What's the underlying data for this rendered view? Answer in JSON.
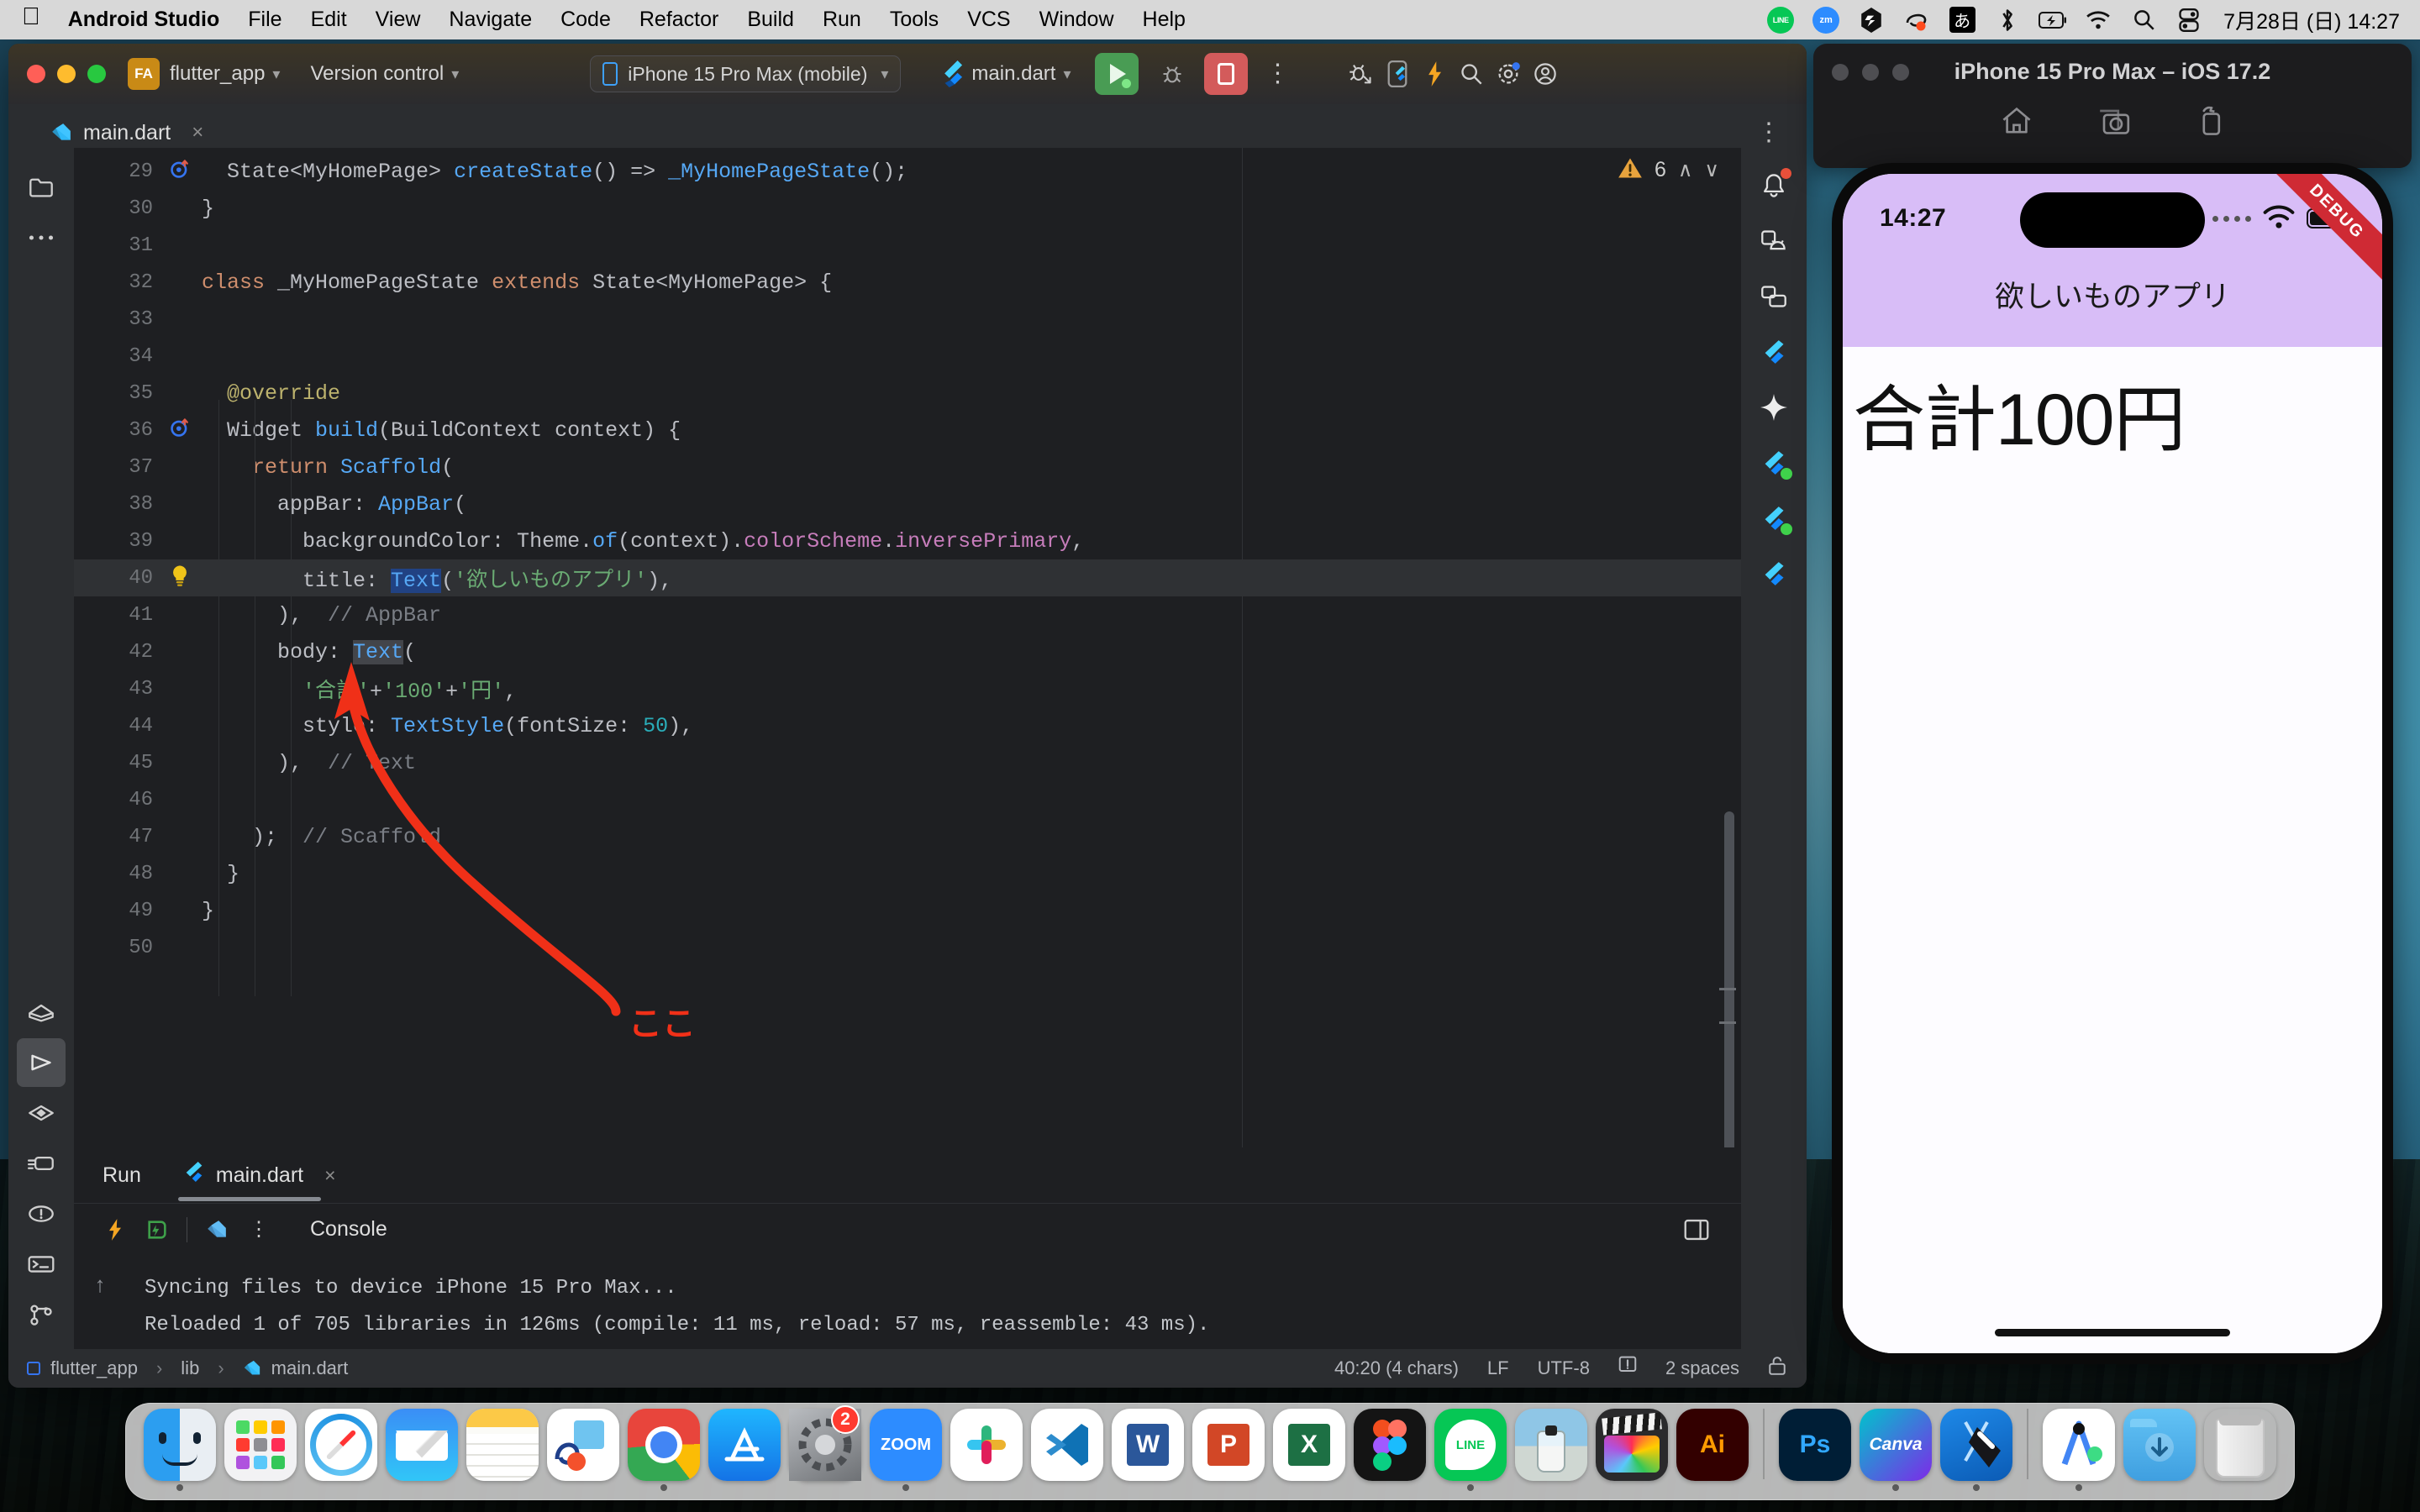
{
  "menubar": {
    "apple": "",
    "items": [
      {
        "label": "Android Studio",
        "bold": true
      },
      {
        "label": "File",
        "bold": false
      },
      {
        "label": "Edit",
        "bold": false
      },
      {
        "label": "View",
        "bold": false
      },
      {
        "label": "Navigate",
        "bold": false
      },
      {
        "label": "Code",
        "bold": false
      },
      {
        "label": "Refactor",
        "bold": false
      },
      {
        "label": "Build",
        "bold": false
      },
      {
        "label": "Run",
        "bold": false
      },
      {
        "label": "Tools",
        "bold": false
      },
      {
        "label": "VCS",
        "bold": false
      },
      {
        "label": "Window",
        "bold": false
      },
      {
        "label": "Help",
        "bold": false
      }
    ],
    "status_icons": [
      "line-icon",
      "zoom-icon",
      "shortcuts-icon",
      "freeform-icon",
      "input-source-japanese-icon",
      "bluetooth-icon",
      "battery-charging-icon",
      "wifi-icon",
      "spotlight-search-icon",
      "control-center-icon"
    ],
    "line_label": "LINE",
    "zoom_label": "zm",
    "input_source": "あ",
    "datetime": "7月28日 (日)  14:27"
  },
  "toolbar": {
    "project_badge": "FA",
    "project_name": "flutter_app",
    "version_control": "Version control",
    "device": "iPhone 15 Pro Max (mobile)",
    "run_config": "main.dart",
    "icons": [
      "run-button",
      "debug-button",
      "stop-button",
      "more-options-kebab",
      "profile-debug-icon",
      "flutter-device-icon",
      "hot-reload-icon",
      "search-everywhere-icon",
      "settings-gear-icon",
      "account-icon"
    ]
  },
  "editor_tab": {
    "filename": "main.dart",
    "close": "×",
    "kebab": "⋮"
  },
  "left_rail": {
    "top_icons": [
      "project-folder-icon",
      "more-tool-windows-icon"
    ],
    "bottom_icons": [
      "build-icon",
      "run-icon",
      "debug-icon",
      "profiler-icon",
      "problems-icon",
      "terminal-icon",
      "version-control-icon"
    ]
  },
  "right_rail": {
    "icons": [
      "notifications-bell-icon",
      "device-manager-icon",
      "resource-manager-icon",
      "flutter-outline-icon",
      "gemini-sparkle-icon",
      "flutter-inspector-icon",
      "flutter-performance-icon",
      "flutter-devtools-icon"
    ]
  },
  "warnings": {
    "icon": "warning-triangle-icon",
    "count": "6",
    "prev": "∧",
    "next": "∨"
  },
  "code": {
    "first_line_number": 29,
    "lines": [
      {
        "n": 29,
        "gutter": "override-marker",
        "tokens": [
          {
            "t": "  ",
            "c": "k-white"
          },
          {
            "t": "State<MyHomePage> ",
            "c": "k-white"
          },
          {
            "t": "createState",
            "c": "k-blue"
          },
          {
            "t": "() => ",
            "c": "k-white"
          },
          {
            "t": "_MyHomePageState",
            "c": "k-blue"
          },
          {
            "t": "();",
            "c": "k-white"
          }
        ]
      },
      {
        "n": 30,
        "gutter": "",
        "tokens": [
          {
            "t": "}",
            "c": "k-white"
          }
        ]
      },
      {
        "n": 31,
        "gutter": "",
        "tokens": [
          {
            "t": "",
            "c": "k-white"
          }
        ]
      },
      {
        "n": 32,
        "gutter": "",
        "tokens": [
          {
            "t": "class",
            "c": "k-orange"
          },
          {
            "t": " _MyHomePageState ",
            "c": "k-white"
          },
          {
            "t": "extends",
            "c": "k-orange"
          },
          {
            "t": " State<MyHomePage> {",
            "c": "k-white"
          }
        ]
      },
      {
        "n": 33,
        "gutter": "",
        "tokens": [
          {
            "t": "",
            "c": "k-white"
          }
        ]
      },
      {
        "n": 34,
        "gutter": "",
        "tokens": [
          {
            "t": "",
            "c": "k-white"
          }
        ]
      },
      {
        "n": 35,
        "gutter": "",
        "tokens": [
          {
            "t": "  ",
            "c": "k-white"
          },
          {
            "t": "@override",
            "c": "k-yellow"
          }
        ]
      },
      {
        "n": 36,
        "gutter": "override-marker",
        "tokens": [
          {
            "t": "  Widget ",
            "c": "k-white"
          },
          {
            "t": "build",
            "c": "k-blue"
          },
          {
            "t": "(BuildContext context) {",
            "c": "k-white"
          }
        ]
      },
      {
        "n": 37,
        "gutter": "",
        "tokens": [
          {
            "t": "    ",
            "c": "k-white"
          },
          {
            "t": "return",
            "c": "k-orange"
          },
          {
            "t": " ",
            "c": "k-white"
          },
          {
            "t": "Scaffold",
            "c": "k-blue"
          },
          {
            "t": "(",
            "c": "k-white"
          }
        ]
      },
      {
        "n": 38,
        "gutter": "",
        "tokens": [
          {
            "t": "      appBar: ",
            "c": "k-white"
          },
          {
            "t": "AppBar",
            "c": "k-blue"
          },
          {
            "t": "(",
            "c": "k-white"
          }
        ]
      },
      {
        "n": 39,
        "gutter": "",
        "tokens": [
          {
            "t": "        backgroundColor: Theme.",
            "c": "k-white"
          },
          {
            "t": "of",
            "c": "k-blue"
          },
          {
            "t": "(context).",
            "c": "k-white"
          },
          {
            "t": "colorScheme",
            "c": "k-purple"
          },
          {
            "t": ".",
            "c": "k-white"
          },
          {
            "t": "inversePrimary",
            "c": "k-purple"
          },
          {
            "t": ",",
            "c": "k-white"
          }
        ]
      },
      {
        "n": 40,
        "gutter": "intention-bulb",
        "highlight": true,
        "tokens": [
          {
            "t": "        title: ",
            "c": "k-white"
          },
          {
            "t": "Text",
            "c": "k-blue sel-blue"
          },
          {
            "t": "(",
            "c": "k-white"
          },
          {
            "t": "'欲しいものアプリ'",
            "c": "k-green"
          },
          {
            "t": "),",
            "c": "k-white"
          }
        ]
      },
      {
        "n": 41,
        "gutter": "",
        "tokens": [
          {
            "t": "      ), ",
            "c": "k-white"
          },
          {
            "t": " // AppBar",
            "c": "k-grey"
          }
        ]
      },
      {
        "n": 42,
        "gutter": "",
        "tokens": [
          {
            "t": "      body: ",
            "c": "k-white"
          },
          {
            "t": "Text",
            "c": "k-blue sel-grey"
          },
          {
            "t": "(",
            "c": "k-white"
          }
        ]
      },
      {
        "n": 43,
        "gutter": "",
        "tokens": [
          {
            "t": "        ",
            "c": "k-white"
          },
          {
            "t": "'合計'",
            "c": "k-green"
          },
          {
            "t": "+",
            "c": "k-white"
          },
          {
            "t": "'100'",
            "c": "k-green"
          },
          {
            "t": "+",
            "c": "k-white"
          },
          {
            "t": "'円'",
            "c": "k-green"
          },
          {
            "t": ",",
            "c": "k-white"
          }
        ]
      },
      {
        "n": 44,
        "gutter": "",
        "tokens": [
          {
            "t": "        style: ",
            "c": "k-white"
          },
          {
            "t": "TextStyle",
            "c": "k-blue"
          },
          {
            "t": "(fontSize: ",
            "c": "k-white"
          },
          {
            "t": "50",
            "c": "k-teal"
          },
          {
            "t": "),",
            "c": "k-white"
          }
        ]
      },
      {
        "n": 45,
        "gutter": "",
        "tokens": [
          {
            "t": "      ), ",
            "c": "k-white"
          },
          {
            "t": " // Text",
            "c": "k-grey"
          }
        ]
      },
      {
        "n": 46,
        "gutter": "",
        "tokens": [
          {
            "t": "",
            "c": "k-white"
          }
        ]
      },
      {
        "n": 47,
        "gutter": "",
        "tokens": [
          {
            "t": "    ); ",
            "c": "k-white"
          },
          {
            "t": " // Scaffold",
            "c": "k-grey"
          }
        ]
      },
      {
        "n": 48,
        "gutter": "",
        "tokens": [
          {
            "t": "  }",
            "c": "k-white"
          }
        ]
      },
      {
        "n": 49,
        "gutter": "",
        "tokens": [
          {
            "t": "}",
            "c": "k-white"
          }
        ]
      },
      {
        "n": 50,
        "gutter": "",
        "tokens": [
          {
            "t": "",
            "c": "k-white"
          }
        ]
      }
    ]
  },
  "annotation": {
    "label": "ここ",
    "color": "#f03018"
  },
  "run_panel": {
    "title": "Run",
    "tab_label": "main.dart",
    "tab_close": "×",
    "toolbar_icons": [
      "hot-reload-icon",
      "hot-restart-icon",
      "flutter-icon",
      "more-kebab-icon"
    ],
    "console_label": "Console",
    "layout_icon": "layout-settings-icon",
    "output": [
      "Syncing files to device iPhone 15 Pro Max...",
      "Reloaded 1 of 705 libraries in 126ms (compile: 11 ms, reload: 57 ms, reassemble: 43 ms)."
    ],
    "rail_icons": [
      "scroll-up-icon",
      "expand-icon"
    ]
  },
  "statusbar": {
    "crumbs": [
      "flutter_app",
      "lib",
      "main.dart"
    ],
    "separator": "›",
    "caret": "40:20 (4 chars)",
    "line_ending": "LF",
    "encoding": "UTF-8",
    "inspections_icon": "inspections-icon",
    "indent": "2 spaces",
    "lock_icon": "read-only-lock-icon"
  },
  "simulator": {
    "window_title": "iPhone 15 Pro Max – iOS 17.2",
    "controls": [
      "home-icon",
      "screenshot-icon",
      "rotate-icon"
    ],
    "status_time": "14:27",
    "status_icons": [
      "cellular-dots-icon",
      "wifi-icon",
      "battery-icon"
    ],
    "debug_ribbon": "DEBUG",
    "app_title": "欲しいものアプリ",
    "body_text": "合計100円",
    "appbar_color": "#d8bdf7"
  },
  "dock": {
    "items": [
      {
        "name": "finder",
        "label": "",
        "kind": "finder",
        "running": true
      },
      {
        "name": "launchpad",
        "label": "",
        "kind": "launchpad",
        "running": false
      },
      {
        "name": "safari",
        "label": "",
        "kind": "safari",
        "running": false
      },
      {
        "name": "mail",
        "label": "",
        "kind": "mail",
        "running": false
      },
      {
        "name": "notes",
        "label": "",
        "kind": "notes",
        "running": false
      },
      {
        "name": "freeform",
        "label": "",
        "kind": "freeform",
        "running": false
      },
      {
        "name": "chrome",
        "label": "",
        "kind": "chrome",
        "running": true
      },
      {
        "name": "app-store",
        "label": "",
        "kind": "appstore",
        "running": false
      },
      {
        "name": "system-settings",
        "label": "",
        "kind": "settings",
        "running": false,
        "badge": "2"
      },
      {
        "name": "zoom",
        "label": "zoom",
        "kind": "zoom",
        "running": true
      },
      {
        "name": "slack",
        "label": "",
        "kind": "slack",
        "running": false
      },
      {
        "name": "vscode",
        "label": "",
        "kind": "vscode",
        "running": false
      },
      {
        "name": "word",
        "label": "W",
        "kind": "word",
        "running": false
      },
      {
        "name": "powerpoint",
        "label": "P",
        "kind": "ppt",
        "running": false
      },
      {
        "name": "excel",
        "label": "X",
        "kind": "excel",
        "running": false
      },
      {
        "name": "figma",
        "label": "",
        "kind": "figma",
        "running": false
      },
      {
        "name": "line",
        "label": "LINE",
        "kind": "line",
        "running": true
      },
      {
        "name": "preview",
        "label": "",
        "kind": "preview",
        "running": false
      },
      {
        "name": "final-cut-pro",
        "label": "",
        "kind": "fcp",
        "running": false
      },
      {
        "name": "illustrator",
        "label": "Ai",
        "kind": "ai",
        "running": false
      },
      {
        "name": "photoshop",
        "label": "Ps",
        "kind": "ps",
        "running": false
      },
      {
        "name": "canva",
        "label": "Canva",
        "kind": "canva",
        "running": true
      },
      {
        "name": "xcode",
        "label": "",
        "kind": "xcode",
        "running": true
      },
      {
        "name": "android-studio",
        "label": "",
        "kind": "androidstudio",
        "running": true
      },
      {
        "name": "downloads-folder",
        "label": "",
        "kind": "folder",
        "running": false
      },
      {
        "name": "trash",
        "label": "",
        "kind": "trash",
        "running": false
      }
    ]
  }
}
